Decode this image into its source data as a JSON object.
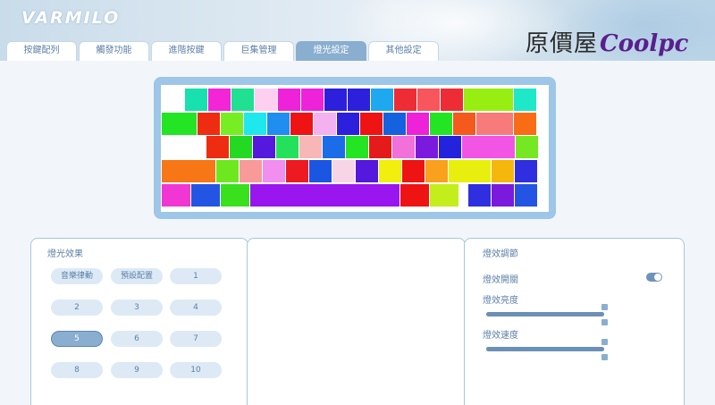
{
  "app": {
    "logo": "VARMILO"
  },
  "watermark": {
    "cn": "原價屋",
    "en": "Coolpc"
  },
  "tabs": [
    {
      "label": "按鍵配列",
      "active": false
    },
    {
      "label": "觸發功能",
      "active": false
    },
    {
      "label": "進階按鍵",
      "active": false
    },
    {
      "label": "巨集管理",
      "active": false
    },
    {
      "label": "燈光設定",
      "active": true
    },
    {
      "label": "其他設定",
      "active": false
    }
  ],
  "keyboard": {
    "rows": [
      [
        "#ffffff",
        "#18e0ae",
        "#f425d6",
        "#20e091",
        "#ffcff2",
        "#ee22d9",
        "#ee22d9",
        "#2d20dd",
        "#2d20dd",
        "#1ea8f0",
        "#ee2c35",
        "#f9555c",
        "#ee2c35",
        "#99ee11",
        "#1fe8c9"
      ],
      [
        "#23e523",
        "#ee2c11",
        "#77ee23",
        "#1ee8ee",
        "#1f8ef0",
        "#ee1414",
        "#f4b1f0",
        "#2d20dd",
        "#ee1414",
        "#1561e0",
        "#ee22d9",
        "#23e523",
        "#f35a1c",
        "#f77b7b",
        "#f96c16"
      ],
      [
        "#ffffff",
        "#ee2c11",
        "#23d923",
        "#5518dd",
        "#23e15a",
        "#f8b6b6",
        "#1a6ce8",
        "#23e523",
        "#e51a1a",
        "#f170d9",
        "#7b19dd",
        "#2323dd",
        "#f255e3",
        "#76e823"
      ],
      [
        "#f77716",
        "#6ee81e",
        "#f89a9a",
        "#f28ef0",
        "#ee1a22",
        "#1b56e3",
        "#f8d5e6",
        "#5518dd",
        "#f2ee0d",
        "#ee1414",
        "#f9a11d",
        "#e8ef0e",
        "#f6b70c",
        "#2f2fe0"
      ],
      [
        "#f037d3",
        "#2354e3",
        "#3ae01d",
        "#9a16ee",
        "#ee1414",
        "#c3ee1c",
        "#ffffff",
        "#2f2fe0",
        "#7b19dd",
        "#2354e3"
      ]
    ]
  },
  "effects_panel": {
    "title": "燈光效果",
    "buttons": [
      {
        "label": "音樂律動",
        "selected": false
      },
      {
        "label": "預設配置",
        "selected": false
      },
      {
        "label": "1",
        "selected": false
      },
      {
        "label": "2",
        "selected": false
      },
      {
        "label": "3",
        "selected": false
      },
      {
        "label": "4",
        "selected": false
      },
      {
        "label": "5",
        "selected": true
      },
      {
        "label": "6",
        "selected": false
      },
      {
        "label": "7",
        "selected": false
      },
      {
        "label": "8",
        "selected": false
      },
      {
        "label": "9",
        "selected": false
      },
      {
        "label": "10",
        "selected": false
      }
    ]
  },
  "adjust_panel": {
    "title": "燈效調節",
    "switch_label": "燈效開關",
    "switch_on": true,
    "brightness_label": "燈效亮度",
    "brightness_value": 1.0,
    "speed_label": "燈效速度",
    "speed_value": 1.0
  }
}
